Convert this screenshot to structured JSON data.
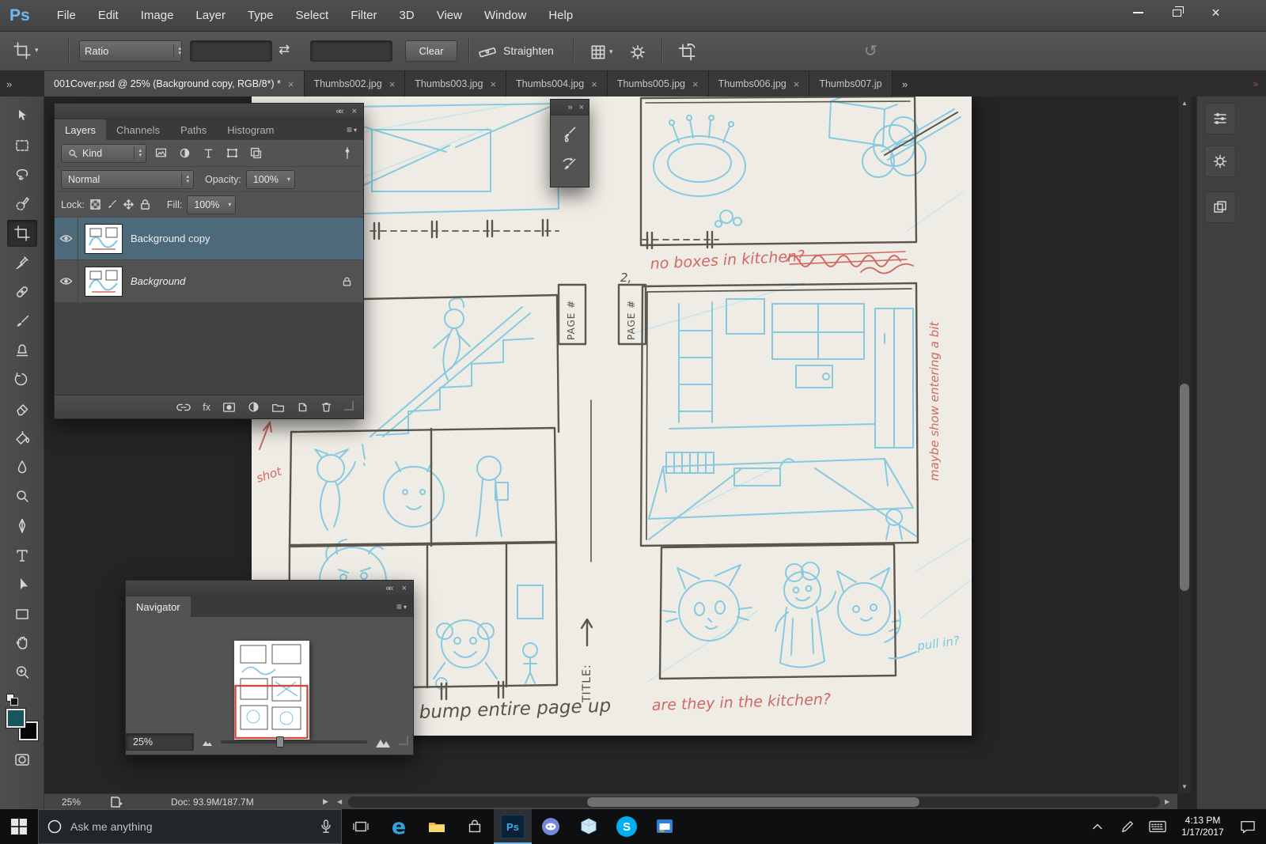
{
  "icons": {
    "close": "×",
    "collapse_left": "««",
    "overflow": "»",
    "dropdown": "▾",
    "up": "▴",
    "menu": "≡",
    "scroll_left": "◀",
    "scroll_right": "▶",
    "scroll_up": "▲",
    "scroll_down": "▼",
    "reset": "↺",
    "swap": "⇄",
    "fx": "fx",
    "edge": "e",
    "ps": "Ps",
    "skype": "S"
  },
  "menu_bar": {
    "logo": "Ps",
    "items": [
      "File",
      "Edit",
      "Image",
      "Layer",
      "Type",
      "Select",
      "Filter",
      "3D",
      "View",
      "Window",
      "Help"
    ]
  },
  "options_bar": {
    "ratio_label": "Ratio",
    "clear_label": "Clear",
    "straighten_label": "Straighten"
  },
  "document_tabs": [
    {
      "label": "001Cover.psd @ 25% (Background copy, RGB/8*) *"
    },
    {
      "label": "Thumbs002.jpg"
    },
    {
      "label": "Thumbs003.jpg"
    },
    {
      "label": "Thumbs004.jpg"
    },
    {
      "label": "Thumbs005.jpg"
    },
    {
      "label": "Thumbs006.jpg"
    },
    {
      "label": "Thumbs007.jp"
    }
  ],
  "tools": [
    "move",
    "rectangular-marquee",
    "lasso",
    "quick-selection",
    "crop",
    "eyedropper",
    "spot-healing-brush",
    "brush",
    "clone-stamp",
    "history-brush",
    "eraser",
    "paint-bucket",
    "blur",
    "dodge",
    "pen",
    "type",
    "path-selection",
    "rectangle",
    "hand",
    "zoom"
  ],
  "layers_panel": {
    "tabs": [
      "Layers",
      "Channels",
      "Paths",
      "Histogram"
    ],
    "kind_label": "Kind",
    "blend_mode": "Normal",
    "opacity_label": "Opacity:",
    "opacity_value": "100%",
    "lock_label": "Lock:",
    "fill_label": "Fill:",
    "fill_value": "100%",
    "layers": [
      {
        "name": "Background copy"
      },
      {
        "name": "Background"
      }
    ]
  },
  "navigator_panel": {
    "title": "Navigator",
    "zoom": "25%"
  },
  "canvas": {
    "page_label": "PAGE #",
    "page_number": "2,",
    "title_label": "TITLE:",
    "notes": {
      "no_boxes": "no boxes in kitchen?",
      "bump": "bump entire page up",
      "kitchen_q": "are they in the kitchen?",
      "maybe": "maybe show entering a bit",
      "pull": "pull in?",
      "shot": "shot"
    }
  },
  "status_bar": {
    "zoom": "25%",
    "doc_info": "Doc: 93.9M/187.7M"
  },
  "taskbar": {
    "search_placeholder": "Ask me anything",
    "clock": {
      "time": "4:13 PM",
      "date": "1/17/2017"
    }
  },
  "colors": {
    "accent_blue": "#31a8ff",
    "sketch_blue": "#7cc7e0",
    "pencil": "#5a564c",
    "note_red": "#cf6a63",
    "foreground_swatch": "#19565c",
    "selected_layer": "#4d6a7b"
  }
}
